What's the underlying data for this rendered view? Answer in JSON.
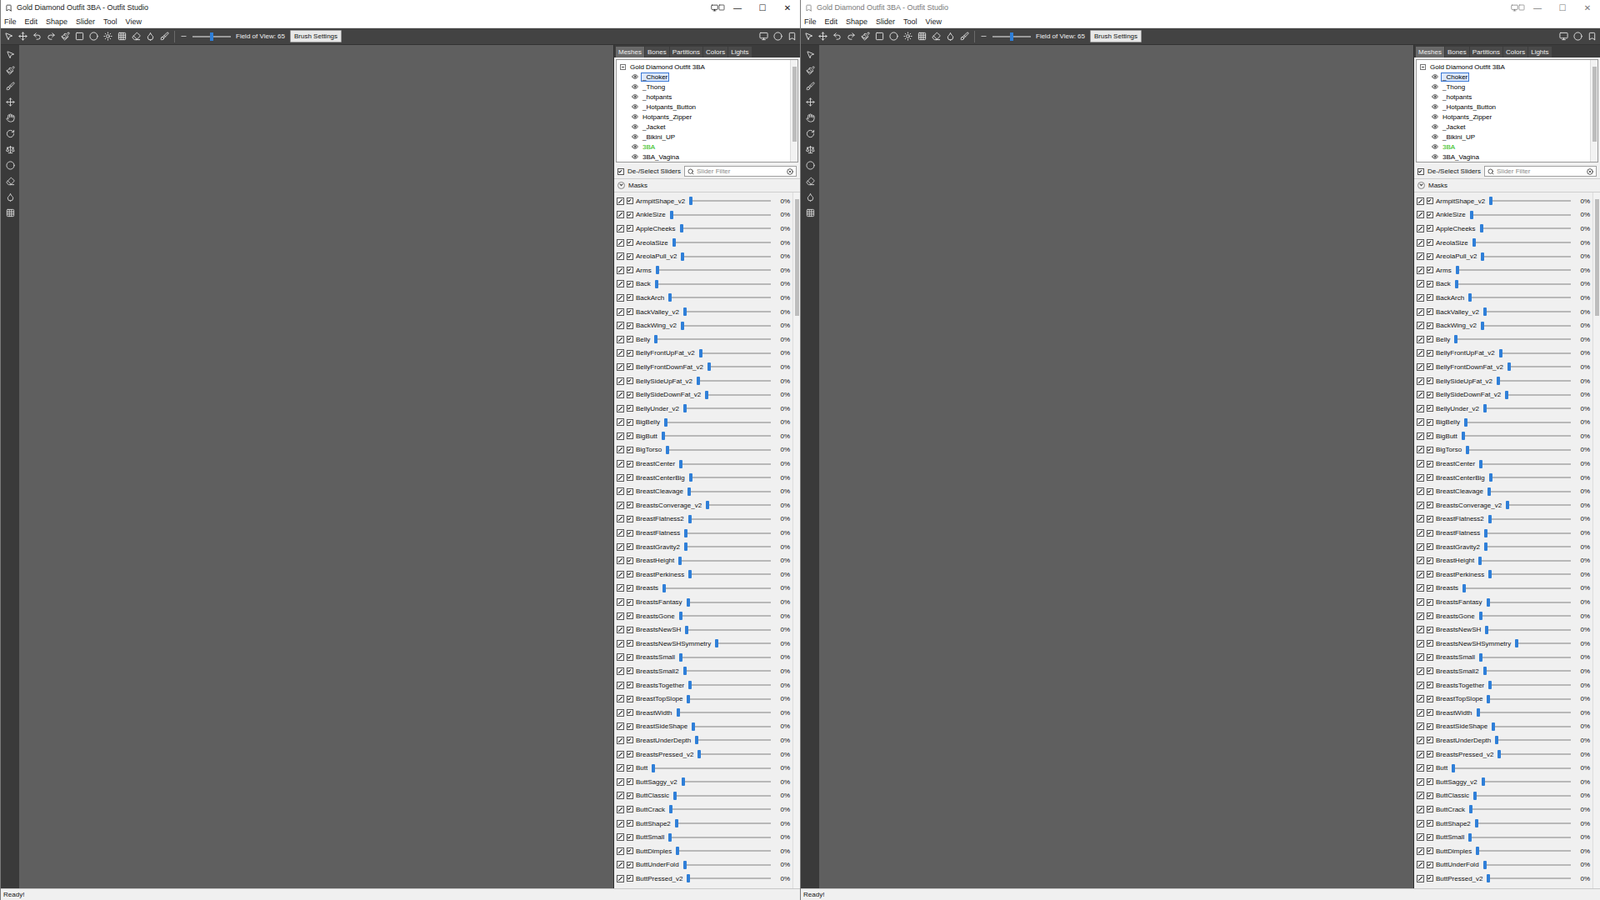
{
  "windows": [
    {
      "title": "Gold Diamond Outfit 3BA - Outfit Studio",
      "active": true,
      "controls": [
        "—",
        "☐",
        "✕"
      ],
      "menu": [
        "File",
        "Edit",
        "Shape",
        "Slider",
        "Tool",
        "View"
      ],
      "toolbar": {
        "fov_label": "Field of View: 65",
        "fov_level": 0.5,
        "brush_button": "Brush Settings"
      },
      "panel": {
        "tabs": [
          {
            "label": "Meshes",
            "selected": true
          },
          {
            "label": "Bones",
            "selected": false
          },
          {
            "label": "Partitions",
            "selected": false
          },
          {
            "label": "Colors",
            "selected": false
          },
          {
            "label": "Lights",
            "selected": false
          }
        ],
        "tree": {
          "root": "Gold Diamond Outfit 3BA",
          "expanded": true,
          "items": [
            {
              "label": "_Choker",
              "selected": true,
              "color": "#000000"
            },
            {
              "label": "_Thong",
              "selected": false,
              "color": "#000000"
            },
            {
              "label": "_hotpants",
              "selected": false,
              "color": "#000000"
            },
            {
              "label": "_Hotpants_Button",
              "selected": false,
              "color": "#000000"
            },
            {
              "label": "Hotpants_Zipper",
              "selected": false,
              "color": "#000000"
            },
            {
              "label": "_Jacket",
              "selected": false,
              "color": "#000000"
            },
            {
              "label": "_Bikini_UP",
              "selected": false,
              "color": "#000000"
            },
            {
              "label": "3BA",
              "selected": false,
              "color": "#22b800"
            },
            {
              "label": "3BA_Vagina",
              "selected": false,
              "color": "#000000"
            }
          ]
        },
        "select_sliders": {
          "label": "De-/Select Sliders",
          "checked": true
        },
        "filter": {
          "placeholder": "Slider Filter"
        },
        "masks": {
          "label": "Masks",
          "expanded": true
        },
        "sliders": [
          {
            "name": "ArmpitShape_v2",
            "value": "0%",
            "level": 0,
            "checked": true
          },
          {
            "name": "AnkleSize",
            "value": "0%",
            "level": 0,
            "checked": true
          },
          {
            "name": "AppleCheeks",
            "value": "0%",
            "level": 0,
            "checked": true
          },
          {
            "name": "AreolaSize",
            "value": "0%",
            "level": 0,
            "checked": true
          },
          {
            "name": "AreolaPull_v2",
            "value": "0%",
            "level": 0,
            "checked": true
          },
          {
            "name": "Arms",
            "value": "0%",
            "level": 0,
            "checked": true
          },
          {
            "name": "Back",
            "value": "0%",
            "level": 0,
            "checked": true
          },
          {
            "name": "BackArch",
            "value": "0%",
            "level": 0,
            "checked": true
          },
          {
            "name": "BackValley_v2",
            "value": "0%",
            "level": 0,
            "checked": true
          },
          {
            "name": "BackWing_v2",
            "value": "0%",
            "level": 0,
            "checked": true
          },
          {
            "name": "Belly",
            "value": "0%",
            "level": 0,
            "checked": true
          },
          {
            "name": "BellyFrontUpFat_v2",
            "value": "0%",
            "level": 0,
            "checked": true
          },
          {
            "name": "BellyFrontDownFat_v2",
            "value": "0%",
            "level": 0,
            "checked": true
          },
          {
            "name": "BellySideUpFat_v2",
            "value": "0%",
            "level": 0,
            "checked": true
          },
          {
            "name": "BellySideDownFat_v2",
            "value": "0%",
            "level": 0,
            "checked": true
          },
          {
            "name": "BellyUnder_v2",
            "value": "0%",
            "level": 0,
            "checked": true
          },
          {
            "name": "BigBelly",
            "value": "0%",
            "level": 0,
            "checked": true
          },
          {
            "name": "BigButt",
            "value": "0%",
            "level": 0,
            "checked": true
          },
          {
            "name": "BigTorso",
            "value": "0%",
            "level": 0,
            "checked": true
          },
          {
            "name": "BreastCenter",
            "value": "0%",
            "level": 0,
            "checked": true
          },
          {
            "name": "BreastCenterBig",
            "value": "0%",
            "level": 0,
            "checked": true
          },
          {
            "name": "BreastCleavage",
            "value": "0%",
            "level": 0,
            "checked": true
          },
          {
            "name": "BreastsConverage_v2",
            "value": "0%",
            "level": 0,
            "checked": true
          },
          {
            "name": "BreastFlatness2",
            "value": "0%",
            "level": 0,
            "checked": true
          },
          {
            "name": "BreastFlatness",
            "value": "0%",
            "level": 0,
            "checked": true
          },
          {
            "name": "BreastGravity2",
            "value": "0%",
            "level": 0,
            "checked": true
          },
          {
            "name": "BreastHeight",
            "value": "0%",
            "level": 0,
            "checked": true
          },
          {
            "name": "BreastPerkiness",
            "value": "0%",
            "level": 0,
            "checked": true
          },
          {
            "name": "Breasts",
            "value": "0%",
            "level": 0,
            "checked": true
          },
          {
            "name": "BreastsFantasy",
            "value": "0%",
            "level": 0,
            "checked": true
          },
          {
            "name": "BreastsGone",
            "value": "0%",
            "level": 0,
            "checked": true
          },
          {
            "name": "BreastsNewSH",
            "value": "0%",
            "level": 0,
            "checked": true
          },
          {
            "name": "BreastsNewSHSymmetry",
            "value": "0%",
            "level": 0,
            "checked": true
          },
          {
            "name": "BreastsSmall",
            "value": "0%",
            "level": 0,
            "checked": true
          },
          {
            "name": "BreastsSmall2",
            "value": "0%",
            "level": 0,
            "checked": true
          },
          {
            "name": "BreastsTogether",
            "value": "0%",
            "level": 0,
            "checked": true
          },
          {
            "name": "BreastTopSlope",
            "value": "0%",
            "level": 0,
            "checked": true
          },
          {
            "name": "BreastWidth",
            "value": "0%",
            "level": 0,
            "checked": true
          },
          {
            "name": "BreastSideShape",
            "value": "0%",
            "level": 0,
            "checked": true
          },
          {
            "name": "BreastUnderDepth",
            "value": "0%",
            "level": 0,
            "checked": true
          },
          {
            "name": "BreastsPressed_v2",
            "value": "0%",
            "level": 0,
            "checked": true
          },
          {
            "name": "Butt",
            "value": "0%",
            "level": 0,
            "checked": true
          },
          {
            "name": "ButtSaggy_v2",
            "value": "0%",
            "level": 0,
            "checked": true
          },
          {
            "name": "ButtClassic",
            "value": "0%",
            "level": 0,
            "checked": true
          },
          {
            "name": "ButtCrack",
            "value": "0%",
            "level": 0,
            "checked": true
          },
          {
            "name": "ButtShape2",
            "value": "0%",
            "level": 0,
            "checked": true
          },
          {
            "name": "ButtSmall",
            "value": "0%",
            "level": 0,
            "checked": true
          },
          {
            "name": "ButtDimples",
            "value": "0%",
            "level": 0,
            "checked": true
          },
          {
            "name": "ButtUnderFold",
            "value": "0%",
            "level": 0,
            "checked": true
          },
          {
            "name": "ButtPressed_v2",
            "value": "0%",
            "level": 0,
            "checked": true
          }
        ]
      },
      "status": "Ready!"
    },
    {
      "title": "Gold Diamond Outfit 3BA - Outfit Studio",
      "active": false,
      "controls": [
        "—",
        "☐",
        "✕"
      ],
      "menu": [
        "File",
        "Edit",
        "Shape",
        "Slider",
        "Tool",
        "View"
      ],
      "toolbar": {
        "fov_label": "Field of View: 65",
        "fov_level": 0.5,
        "brush_button": "Brush Settings"
      },
      "panel": {
        "tabs": [
          {
            "label": "Meshes",
            "selected": true
          },
          {
            "label": "Bones",
            "selected": false
          },
          {
            "label": "Partitions",
            "selected": false
          },
          {
            "label": "Colors",
            "selected": false
          },
          {
            "label": "Lights",
            "selected": false
          }
        ],
        "tree": {
          "root": "Gold Diamond Outfit 3BA",
          "expanded": true,
          "items": [
            {
              "label": "_Choker",
              "selected": true,
              "color": "#000000"
            },
            {
              "label": "_Thong",
              "selected": false,
              "color": "#000000"
            },
            {
              "label": "_hotpants",
              "selected": false,
              "color": "#000000"
            },
            {
              "label": "_Hotpants_Button",
              "selected": false,
              "color": "#000000"
            },
            {
              "label": "Hotpants_Zipper",
              "selected": false,
              "color": "#000000"
            },
            {
              "label": "_Jacket",
              "selected": false,
              "color": "#000000"
            },
            {
              "label": "_Bikini_UP",
              "selected": false,
              "color": "#000000"
            },
            {
              "label": "3BA",
              "selected": false,
              "color": "#22b800"
            },
            {
              "label": "3BA_Vagina",
              "selected": false,
              "color": "#000000"
            }
          ]
        },
        "select_sliders": {
          "label": "De-/Select Sliders",
          "checked": true
        },
        "filter": {
          "placeholder": "Slider Filter"
        },
        "masks": {
          "label": "Masks",
          "expanded": true
        },
        "sliders": [
          {
            "name": "ArmpitShape_v2",
            "value": "0%",
            "level": 0,
            "checked": true
          },
          {
            "name": "AnkleSize",
            "value": "0%",
            "level": 0,
            "checked": true
          },
          {
            "name": "AppleCheeks",
            "value": "0%",
            "level": 0,
            "checked": true
          },
          {
            "name": "AreolaSize",
            "value": "0%",
            "level": 0,
            "checked": true
          },
          {
            "name": "AreolaPull_v2",
            "value": "0%",
            "level": 0,
            "checked": true
          },
          {
            "name": "Arms",
            "value": "0%",
            "level": 0,
            "checked": true
          },
          {
            "name": "Back",
            "value": "0%",
            "level": 0,
            "checked": true
          },
          {
            "name": "BackArch",
            "value": "0%",
            "level": 0,
            "checked": true
          },
          {
            "name": "BackValley_v2",
            "value": "0%",
            "level": 0,
            "checked": true
          },
          {
            "name": "BackWing_v2",
            "value": "0%",
            "level": 0,
            "checked": true
          },
          {
            "name": "Belly",
            "value": "0%",
            "level": 0,
            "checked": true
          },
          {
            "name": "BellyFrontUpFat_v2",
            "value": "0%",
            "level": 0,
            "checked": true
          },
          {
            "name": "BellyFrontDownFat_v2",
            "value": "0%",
            "level": 0,
            "checked": true
          },
          {
            "name": "BellySideUpFat_v2",
            "value": "0%",
            "level": 0,
            "checked": true
          },
          {
            "name": "BellySideDownFat_v2",
            "value": "0%",
            "level": 0,
            "checked": true
          },
          {
            "name": "BellyUnder_v2",
            "value": "0%",
            "level": 0,
            "checked": true
          },
          {
            "name": "BigBelly",
            "value": "0%",
            "level": 0,
            "checked": true
          },
          {
            "name": "BigButt",
            "value": "0%",
            "level": 0,
            "checked": true
          },
          {
            "name": "BigTorso",
            "value": "0%",
            "level": 0,
            "checked": true
          },
          {
            "name": "BreastCenter",
            "value": "0%",
            "level": 0,
            "checked": true
          },
          {
            "name": "BreastCenterBig",
            "value": "0%",
            "level": 0,
            "checked": true
          },
          {
            "name": "BreastCleavage",
            "value": "0%",
            "level": 0,
            "checked": true
          },
          {
            "name": "BreastsConverage_v2",
            "value": "0%",
            "level": 0,
            "checked": true
          },
          {
            "name": "BreastFlatness2",
            "value": "0%",
            "level": 0,
            "checked": true
          },
          {
            "name": "BreastFlatness",
            "value": "0%",
            "level": 0,
            "checked": true
          },
          {
            "name": "BreastGravity2",
            "value": "0%",
            "level": 0,
            "checked": true
          },
          {
            "name": "BreastHeight",
            "value": "0%",
            "level": 0,
            "checked": true
          },
          {
            "name": "BreastPerkiness",
            "value": "0%",
            "level": 0,
            "checked": true
          },
          {
            "name": "Breasts",
            "value": "0%",
            "level": 0,
            "checked": true
          },
          {
            "name": "BreastsFantasy",
            "value": "0%",
            "level": 0,
            "checked": true
          },
          {
            "name": "BreastsGone",
            "value": "0%",
            "level": 0,
            "checked": true
          },
          {
            "name": "BreastsNewSH",
            "value": "0%",
            "level": 0,
            "checked": true
          },
          {
            "name": "BreastsNewSHSymmetry",
            "value": "0%",
            "level": 0,
            "checked": true
          },
          {
            "name": "BreastsSmall",
            "value": "0%",
            "level": 0,
            "checked": true
          },
          {
            "name": "BreastsSmall2",
            "value": "0%",
            "level": 0,
            "checked": true
          },
          {
            "name": "BreastsTogether",
            "value": "0%",
            "level": 0,
            "checked": true
          },
          {
            "name": "BreastTopSlope",
            "value": "0%",
            "level": 0,
            "checked": true
          },
          {
            "name": "BreastWidth",
            "value": "0%",
            "level": 0,
            "checked": true
          },
          {
            "name": "BreastSideShape",
            "value": "0%",
            "level": 0,
            "checked": true
          },
          {
            "name": "BreastUnderDepth",
            "value": "0%",
            "level": 0,
            "checked": true
          },
          {
            "name": "BreastsPressed_v2",
            "value": "0%",
            "level": 0,
            "checked": true
          },
          {
            "name": "Butt",
            "value": "0%",
            "level": 0,
            "checked": true
          },
          {
            "name": "ButtSaggy_v2",
            "value": "0%",
            "level": 0,
            "checked": true
          },
          {
            "name": "ButtClassic",
            "value": "0%",
            "level": 0,
            "checked": true
          },
          {
            "name": "ButtCrack",
            "value": "0%",
            "level": 0,
            "checked": true
          },
          {
            "name": "ButtShape2",
            "value": "0%",
            "level": 0,
            "checked": true
          },
          {
            "name": "ButtSmall",
            "value": "0%",
            "level": 0,
            "checked": true
          },
          {
            "name": "ButtDimples",
            "value": "0%",
            "level": 0,
            "checked": true
          },
          {
            "name": "ButtUnderFold",
            "value": "0%",
            "level": 0,
            "checked": true
          },
          {
            "name": "ButtPressed_v2",
            "value": "0%",
            "level": 0,
            "checked": true
          }
        ]
      },
      "status": "Ready!"
    }
  ]
}
